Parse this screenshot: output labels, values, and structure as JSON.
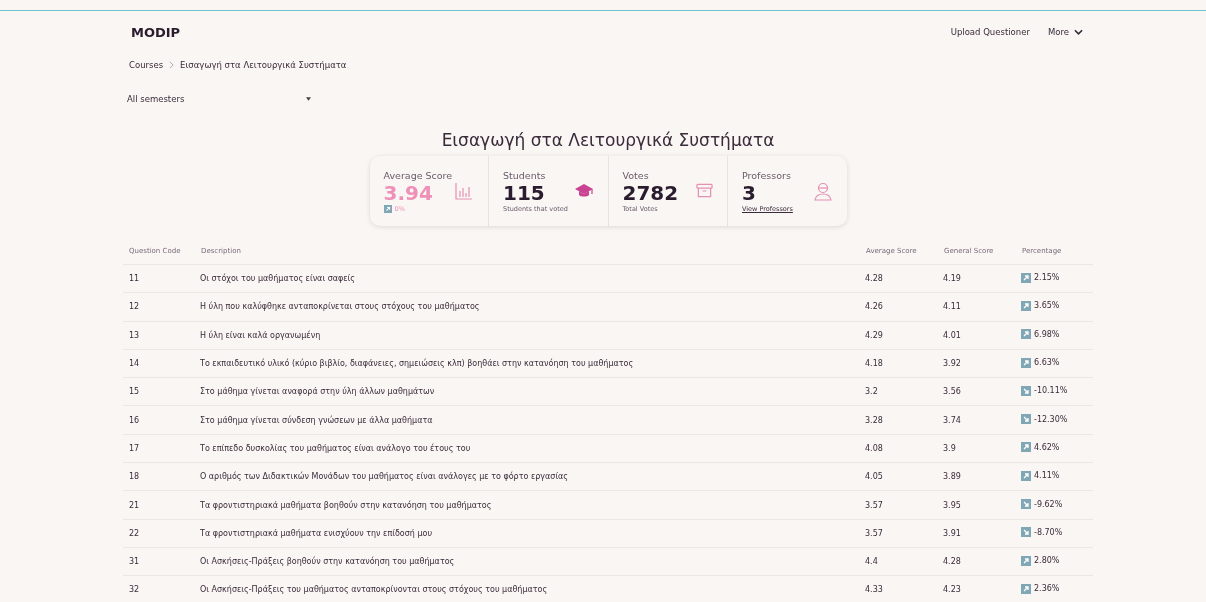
{
  "header": {
    "brand": "MODIP",
    "nav": [
      "Upload Questioner",
      "More"
    ]
  },
  "breadcrumb": [
    "Courses",
    "Εισαγωγή στα Λειτουργικά Συστήματα"
  ],
  "semester_select": {
    "value": "All semesters"
  },
  "title": "Εισαγωγή στα Λειτουργικά Συστήματα",
  "stats": [
    {
      "kind": "score",
      "label": "Average Score",
      "value": "3.94",
      "rising": true,
      "change": "0%"
    },
    {
      "kind": "students",
      "label": "Students",
      "value": "115",
      "caption": "Students that voted"
    },
    {
      "kind": "votes",
      "label": "Votes",
      "value": "2782",
      "caption": "Total Votes"
    },
    {
      "kind": "professors",
      "label": "Professors",
      "value": "3",
      "link": "View Professors"
    }
  ],
  "table": {
    "columns": [
      "Question Code",
      "Description",
      "Average Score",
      "General Score",
      "Percentage"
    ],
    "rows": [
      {
        "code": "11",
        "description": "Οι στόχοι του μαθήματος είναι σαφείς",
        "average": "4.28",
        "general": "4.19",
        "rising": true,
        "percentage": "2.15%"
      },
      {
        "code": "12",
        "description": "Η ύλη που καλύφθηκε ανταποκρίνεται στους στόχους του μαθήματος",
        "average": "4.26",
        "general": "4.11",
        "rising": true,
        "percentage": "3.65%"
      },
      {
        "code": "13",
        "description": "Η ύλη είναι καλά οργανωμένη",
        "average": "4.29",
        "general": "4.01",
        "rising": true,
        "percentage": "6.98%"
      },
      {
        "code": "14",
        "description": "Το εκπαιδευτικό υλικό (κύριο βιβλίο, διαφάνειες, σημειώσεις κλπ) βοηθάει στην κατανόηση του μαθήματος",
        "average": "4.18",
        "general": "3.92",
        "rising": true,
        "percentage": "6.63%"
      },
      {
        "code": "15",
        "description": "Στο μάθημα γίνεται αναφορά στην ύλη άλλων μαθημάτων",
        "average": "3.2",
        "general": "3.56",
        "rising": false,
        "percentage": "-10.11%"
      },
      {
        "code": "16",
        "description": "Στο μάθημα γίνεται σύνδεση γνώσεων με άλλα μαθήματα",
        "average": "3.28",
        "general": "3.74",
        "rising": false,
        "percentage": "-12.30%"
      },
      {
        "code": "17",
        "description": "Το επίπεδο δυσκολίας του μαθήματος είναι ανάλογο του έτους του",
        "average": "4.08",
        "general": "3.9",
        "rising": true,
        "percentage": "4.62%"
      },
      {
        "code": "18",
        "description": "Ο αριθμός των Διδακτικών Μονάδων του μαθήματος είναι ανάλογες με το φόρτο εργασίας",
        "average": "4.05",
        "general": "3.89",
        "rising": true,
        "percentage": "4.11%"
      },
      {
        "code": "21",
        "description": "Τα φροντιστηριακά μαθήματα βοηθούν στην κατανόηση του μαθήματος",
        "average": "3.57",
        "general": "3.95",
        "rising": false,
        "percentage": "-9.62%"
      },
      {
        "code": "22",
        "description": "Τα φροντιστηριακά μαθήματα ενισχύουν την επίδοσή μου",
        "average": "3.57",
        "general": "3.91",
        "rising": false,
        "percentage": "-8.70%"
      },
      {
        "code": "31",
        "description": "Οι Ασκήσεις-Πράξεις βοηθούν στην κατανόηση του μαθήματος",
        "average": "4.4",
        "general": "4.28",
        "rising": true,
        "percentage": "2.80%"
      },
      {
        "code": "32",
        "description": "Οι Ασκήσεις-Πράξεις του μαθήματος ανταποκρίνονται στους στόχους του μαθήματος",
        "average": "4.33",
        "general": "4.23",
        "rising": true,
        "percentage": "2.36%"
      }
    ]
  }
}
